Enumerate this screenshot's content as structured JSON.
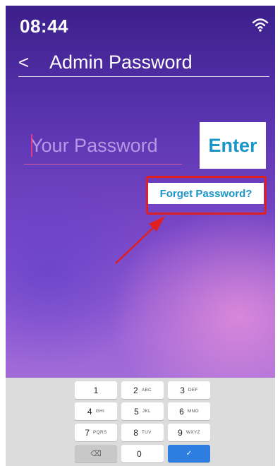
{
  "status_bar": {
    "time": "08:44",
    "wifi_icon": "wifi-icon"
  },
  "header": {
    "back_icon": "chevron-left-icon",
    "back_glyph": "<",
    "title": "Admin Password"
  },
  "password": {
    "placeholder": "Your Password",
    "value": ""
  },
  "enter_label": "Enter",
  "forget_label": "Forget Password?",
  "keypad": {
    "rows": [
      [
        {
          "num": "1",
          "letters": ""
        },
        {
          "num": "2",
          "letters": "ABC"
        },
        {
          "num": "3",
          "letters": "DEF"
        }
      ],
      [
        {
          "num": "4",
          "letters": "GHI"
        },
        {
          "num": "5",
          "letters": "JKL"
        },
        {
          "num": "6",
          "letters": "MNO"
        }
      ],
      [
        {
          "num": "7",
          "letters": "PQRS"
        },
        {
          "num": "8",
          "letters": "TUV"
        },
        {
          "num": "9",
          "letters": "WXYZ"
        }
      ]
    ],
    "bottom_row": {
      "delete_glyph": "⌫",
      "zero": "0",
      "done_glyph": "✓"
    }
  },
  "colors": {
    "accent": "#1a96c8",
    "highlight": "#e02020",
    "done_key": "#2d7ee0",
    "keypad_bg": "#dcdcdc"
  }
}
